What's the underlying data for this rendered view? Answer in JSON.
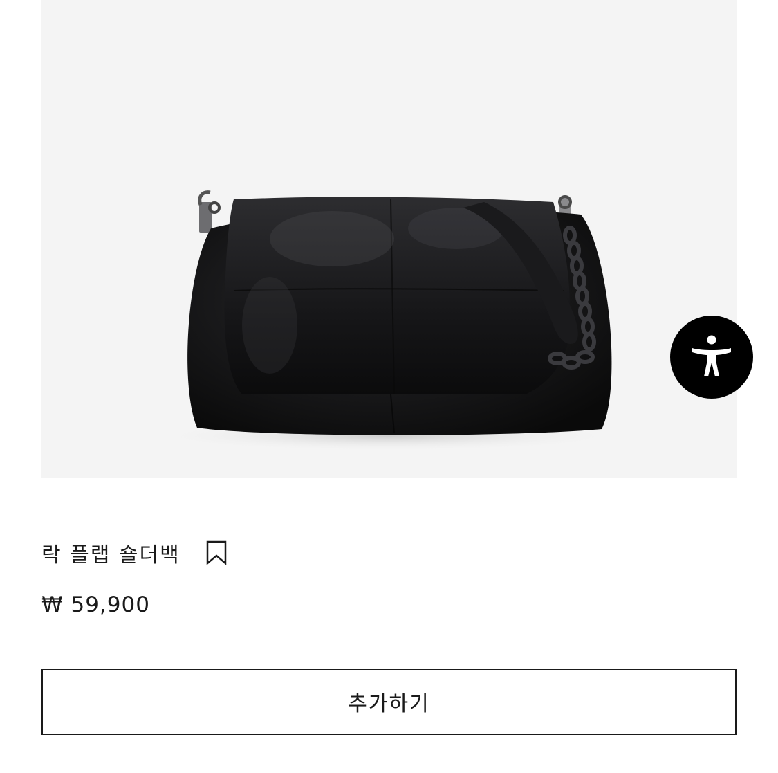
{
  "product": {
    "name": "락 플랩 숄더백",
    "price": "₩ 59,900",
    "add_button_label": "추가하기",
    "image_icon": "shoulder-bag-photo",
    "bookmark_icon": "bookmark-icon"
  },
  "accessibility": {
    "icon": "accessibility-person-icon"
  },
  "colors": {
    "image_background": "#f4f4f4",
    "text": "#1a1a1a",
    "accessibility_button": "#000000"
  }
}
